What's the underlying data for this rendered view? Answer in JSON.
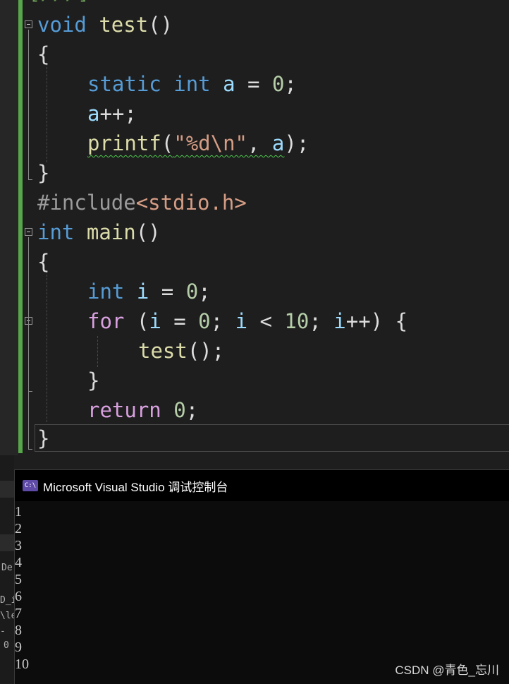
{
  "editor": {
    "top_fragment": "[///]",
    "lines": {
      "l1": {
        "kw": "void",
        "name": "test",
        "paren": "()"
      },
      "l2": {
        "brace": "{"
      },
      "l3": {
        "kw1": "static",
        "kw2": "int",
        "var": "a",
        "eq": " = ",
        "num": "0",
        "semi": ";"
      },
      "l4": {
        "var": "a",
        "rest": "++;"
      },
      "l5": {
        "fn": "printf",
        "open": "(",
        "str": "\"%d\\n\"",
        "comma": ", ",
        "var": "a",
        "close": ");"
      },
      "l6": {
        "brace": "}"
      },
      "l7": {
        "pp": "#include",
        "hdr": "<stdio.h>"
      },
      "l8": {
        "kw": "int",
        "name": "main",
        "paren": "()"
      },
      "l9": {
        "brace": "{"
      },
      "l10": {
        "kw": "int",
        "var": "i",
        "eq": " = ",
        "num": "0",
        "semi": ";"
      },
      "l11": {
        "kw": "for",
        "p1": " (",
        "v1": "i",
        "eq": " = ",
        "n1": "0",
        "s1": "; ",
        "v2": "i",
        "lt": " < ",
        "n2": "10",
        "s2": "; ",
        "v3": "i",
        "inc": "++",
        "p2": ") {"
      },
      "l12": {
        "fn": "test",
        "rest": "();"
      },
      "l13": {
        "brace": "}"
      },
      "l14": {
        "kw": "return",
        "sp": " ",
        "num": "0",
        "semi": ";"
      },
      "l15": {
        "brace": "}"
      }
    }
  },
  "console": {
    "icon_text": "C:\\",
    "title": "Microsoft Visual Studio 调试控制台",
    "output": [
      "1",
      "2",
      "3",
      "4",
      "5",
      "6",
      "7",
      "8",
      "9",
      "10"
    ]
  },
  "background_window": {
    "fragments": [
      "De",
      "D_i",
      "\\le",
      "-",
      "0"
    ]
  },
  "watermark": "CSDN @青色_忘川",
  "colors": {
    "keyword": "#569cd6",
    "control": "#d8a0df",
    "function": "#dcdcaa",
    "variable": "#9cdcfe",
    "number": "#b5cea8",
    "string": "#d69d85",
    "change_bar": "#57a64a"
  }
}
